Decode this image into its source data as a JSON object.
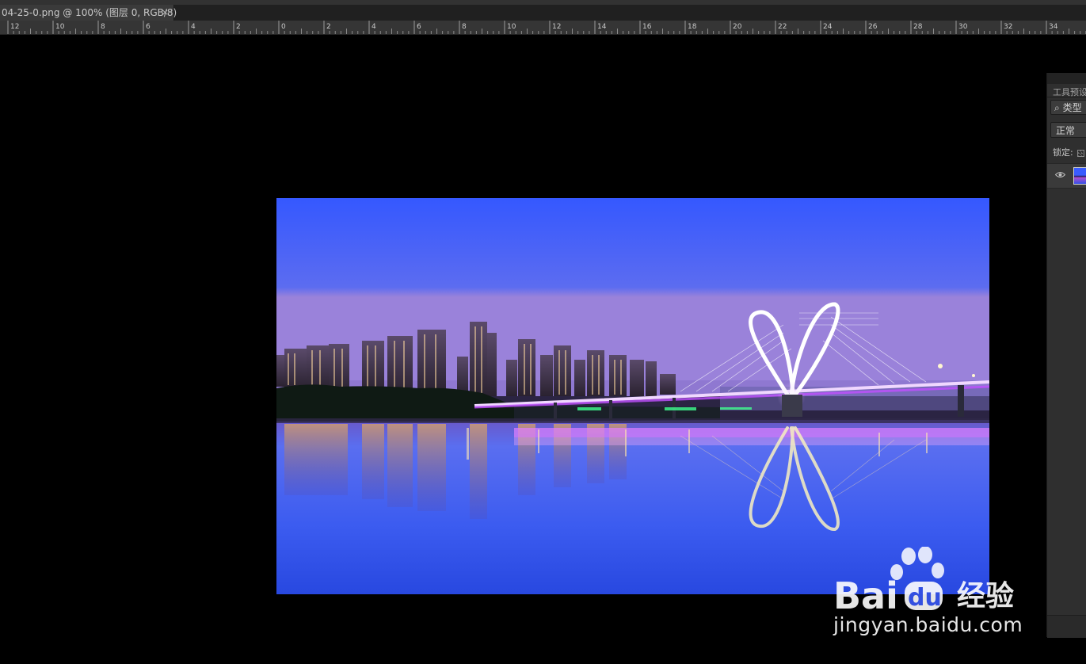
{
  "document_tab": {
    "title": "04-25-0.png @ 100% (图层 0, RGB/8)",
    "close_glyph": "×"
  },
  "ruler": {
    "labels": [
      "12",
      "10",
      "8",
      "6",
      "4",
      "2",
      "0",
      "2",
      "4",
      "6",
      "8",
      "10",
      "12",
      "14",
      "16",
      "18",
      "20",
      "22",
      "24",
      "26",
      "28",
      "30",
      "32",
      "34"
    ]
  },
  "canvas": {
    "image_description": "night-city-bridge-photo"
  },
  "layers_panel": {
    "title": "工具预设",
    "filter_label": "类型",
    "blend_mode": "正常",
    "lock_label": "锁定:",
    "layer_visibility_icon": "eye-icon"
  },
  "watermark": {
    "brand_left": "Bai",
    "brand_right": "du",
    "brand_cn": "经验",
    "url": "jingyan.baidu.com"
  },
  "colors": {
    "sky_top": "#3a5cff",
    "sky_horizon": "#8f7ce0",
    "water": "#2f4ee8",
    "bridge_light": "#e8c8ff",
    "accent_purple": "#c050ff"
  }
}
